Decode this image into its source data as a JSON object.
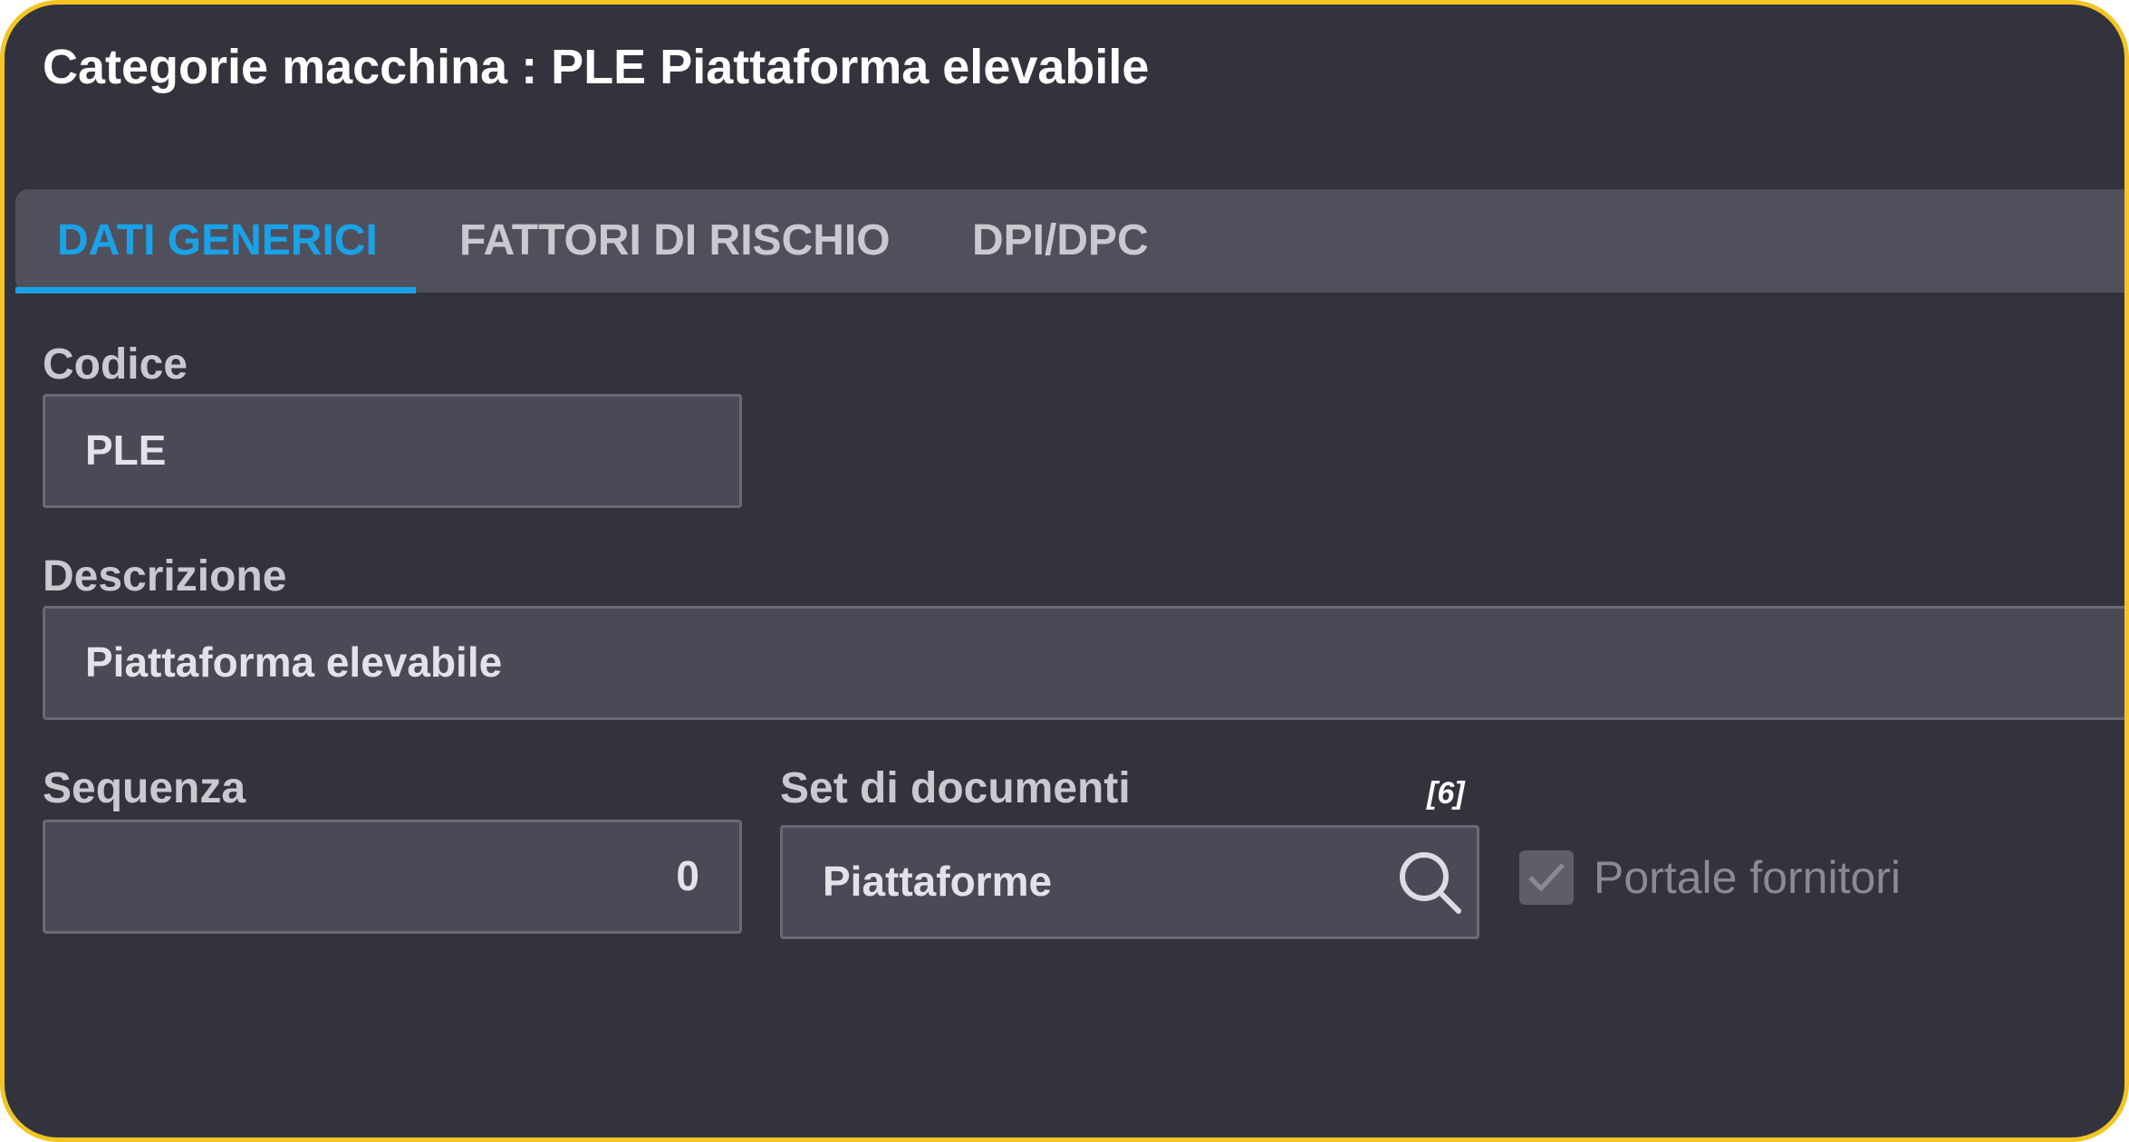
{
  "window": {
    "title": "Categorie macchina : PLE Piattaforma elevabile"
  },
  "tabs": [
    {
      "label": "DATI GENERICI",
      "active": true
    },
    {
      "label": "FATTORI DI RISCHIO",
      "active": false
    },
    {
      "label": "DPI/DPC",
      "active": false
    }
  ],
  "form": {
    "codice": {
      "label": "Codice",
      "value": "PLE"
    },
    "descrizione": {
      "label": "Descrizione",
      "value": "Piattaforma elevabile"
    },
    "sequenza": {
      "label": "Sequenza",
      "value": "0"
    },
    "set_documenti": {
      "label": "Set di documenti",
      "value": "Piattaforme",
      "count": "[6]",
      "icon": "search-icon"
    },
    "portale_fornitori": {
      "label": "Portale fornitori",
      "checked": true
    }
  },
  "colors": {
    "background": "#33333e",
    "border": "#f2c523",
    "accent": "#1aa2e8",
    "tabbar": "#50505d",
    "field": "#4a4a56"
  }
}
